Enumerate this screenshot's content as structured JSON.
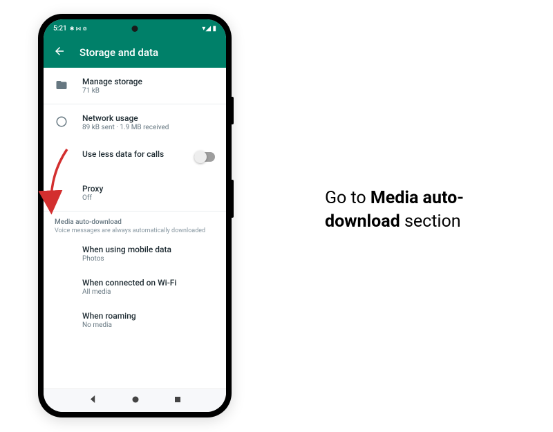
{
  "status_bar": {
    "time": "5:21",
    "icons_left": "✱ ⋈ ⊚",
    "icons_right": "▾◢ ▮"
  },
  "app_bar": {
    "title": "Storage and data"
  },
  "items": {
    "manage_storage": {
      "title": "Manage storage",
      "sub": "71 kB"
    },
    "network_usage": {
      "title": "Network usage",
      "sub": "89 kB sent · 1.9 MB received"
    },
    "use_less_data": {
      "title": "Use less data for calls"
    },
    "proxy": {
      "title": "Proxy",
      "sub": "Off"
    }
  },
  "section": {
    "title": "Media auto-download",
    "sub": "Voice messages are always automatically downloaded"
  },
  "sub_items": {
    "mobile": {
      "title": "When using mobile data",
      "sub": "Photos"
    },
    "wifi": {
      "title": "When connected on Wi-Fi",
      "sub": "All media"
    },
    "roaming": {
      "title": "When roaming",
      "sub": "No media"
    }
  },
  "instruction": {
    "pre": "Go to ",
    "bold": "Media auto-download",
    "post": " section"
  }
}
